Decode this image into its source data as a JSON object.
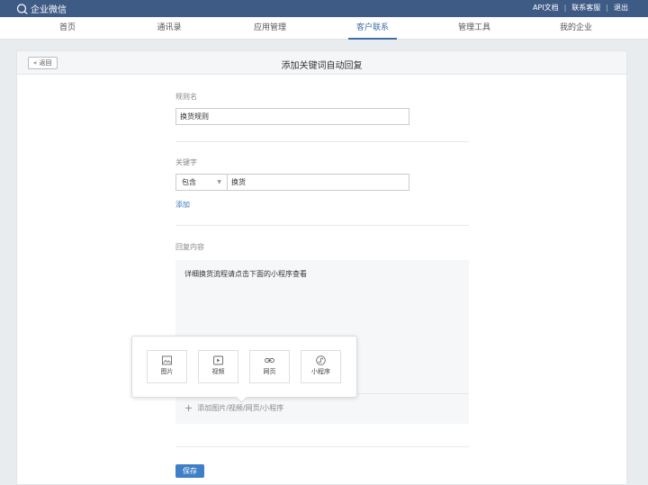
{
  "topbar": {
    "app_name": "企业微信",
    "links": [
      "API文档",
      "联系客服",
      "退出"
    ]
  },
  "nav": {
    "items": [
      "首页",
      "通讯录",
      "应用管理",
      "客户联系",
      "管理工具",
      "我的企业"
    ],
    "active": "客户联系"
  },
  "page": {
    "back_label": "« 返回",
    "title": "添加关键词自动回复"
  },
  "form": {
    "rule_name_label": "规则名",
    "rule_name_value": "换货规则",
    "keyword_label": "关键字",
    "match_mode": "包含",
    "keyword_value": "换货",
    "add_keyword_link": "添加",
    "reply_label": "回复内容",
    "reply_text": "详细换货流程请点击下面的小程序查看",
    "add_media_label": "添加图片/视频/网页/小程序",
    "save_label": "保存"
  },
  "media_popover": {
    "image_label": "图片",
    "video_label": "视频",
    "webpage_label": "网页",
    "miniprogram_label": "小程序"
  },
  "colors": {
    "topbar_bg": "#3e5b86",
    "accent": "#3f78b7",
    "save_button": "#3f7fc6"
  }
}
